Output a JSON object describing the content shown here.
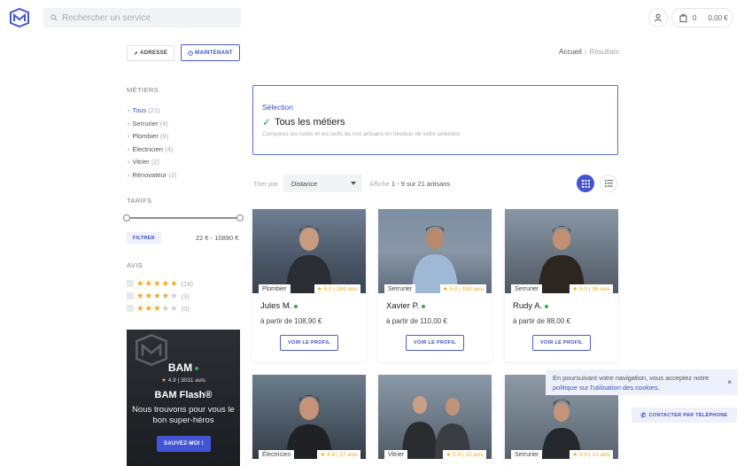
{
  "header": {
    "search_placeholder": "Rechercher un service",
    "cart_count": "0",
    "cart_total": "0,00 €"
  },
  "actions": {
    "adresse": "ADRESSE",
    "maintenant": "MAINTENANT"
  },
  "breadcrumb": {
    "home": "Accueil",
    "separator": "›",
    "current": "Résultats"
  },
  "sidebar": {
    "metiers_title": "MÉTIERS",
    "metiers": [
      {
        "label": "Tous",
        "count": "(21)",
        "active": true
      },
      {
        "label": "Serrurier",
        "count": "(4)"
      },
      {
        "label": "Plombier",
        "count": "(9)"
      },
      {
        "label": "Électricien",
        "count": "(4)"
      },
      {
        "label": "Vitrier",
        "count": "(2)"
      },
      {
        "label": "Rénovateur",
        "count": "(3)"
      }
    ],
    "tarifs_title": "TARIFS",
    "price_min": 0.0,
    "price_max": 1.0,
    "filtrer": "FILTRER",
    "price_range": "22 € - 10890 €",
    "avis_title": "AVIS",
    "avis": [
      {
        "stars": 5,
        "count": "(18)"
      },
      {
        "stars": 4,
        "count": "(3)"
      },
      {
        "stars": 3,
        "count": "(0)"
      }
    ]
  },
  "promo": {
    "title": "BAM",
    "rating": "4.9 | 3031 avis",
    "flash": "BAM Flash®",
    "text": "Nous trouvons pour vous le bon super-héros",
    "button": "SAUVEZ-MOI !"
  },
  "selection": {
    "label": "Sélection",
    "title": "Tous les métiers",
    "description": "Comparez les notes et les tarifs de nos artisans en fonction de votre sélection"
  },
  "toolbar": {
    "trier_label": "Trier par",
    "sort_value": "Distance",
    "affiche_prefix": "Affiche",
    "affiche_range": "1 - 9 sur 21 artisans"
  },
  "cards": [
    {
      "tag": "Plombier",
      "rating": "5.0 | 269 avis",
      "name": "Jules M.",
      "price": "à partir de 108,90 €",
      "button": "VOIR LE PROFIL"
    },
    {
      "tag": "Serrurier",
      "rating": "5.0 | 153 avis",
      "name": "Xavier P.",
      "price": "à partir de 110,00 €",
      "button": "VOIR LE PROFIL"
    },
    {
      "tag": "Serrurier",
      "rating": "5.0 | 36 avis",
      "name": "Rudy A.",
      "price": "à partir de 88,00 €",
      "button": "VOIR LE PROFIL"
    },
    {
      "tag": "Électricien",
      "rating": "4.6 | 37 avis"
    },
    {
      "tag": "Vitrier",
      "rating": "5.0 | 15 avis"
    },
    {
      "tag": "Serrurier",
      "rating": "5.0 | 13 avis"
    }
  ],
  "cookie": {
    "text_before": "En poursuivant votre navigation, vous acceptez notre",
    "link": "politique sur l'utilisation des cookies",
    "text_after": ".",
    "close": "×"
  },
  "call_button": "CONTACTER PAR TÉLÉPHONE",
  "colors": {
    "accent": "#4354d5",
    "star": "#f3a81c",
    "online": "#3ba55c"
  }
}
